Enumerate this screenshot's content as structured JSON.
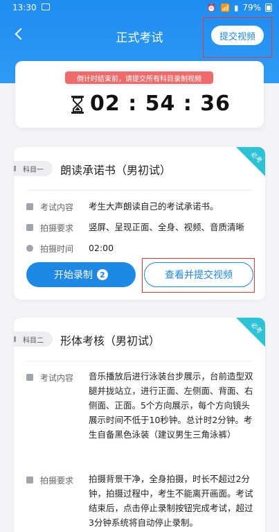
{
  "status_bar": {
    "time": "13:30",
    "battery": "79%",
    "icons": [
      "image-icon",
      "alarm-icon",
      "wifi-icon",
      "signal-icon",
      "battery-icon"
    ]
  },
  "header": {
    "title": "正式考试",
    "submit_video_label": "提交视频"
  },
  "timer": {
    "tip": "倒计时结束前，请提交所有科目录制视频",
    "countdown": "02 : 54 : 36"
  },
  "subjects": [
    {
      "tag": "科目一",
      "title": "朗读承诺书（男初试）",
      "required_label": "必考",
      "rows": [
        {
          "label": "考试内容",
          "value": "考生大声朗读自己的考试承诺书。"
        },
        {
          "label": "拍摄要求",
          "value": "竖屏、呈现正面、全身、视频、音质清晰"
        },
        {
          "label": "拍摄时间",
          "value": "02:00"
        }
      ],
      "start_label": "开始录制",
      "start_badge": "2",
      "view_label": "查看并提交视频"
    },
    {
      "tag": "科目二",
      "title": "形体考核（男初试）",
      "required_label": "必考",
      "rows": [
        {
          "label": "考试内容",
          "value": "音乐播放后进行泳装台步展示，台前造型双腿并拢站立，进行正面、左侧面、背面、右侧面、正面。5个方向展示，每个方向镜头展示时间不低于10秒钟。总计时2分钟。考生自备黑色泳装（建议男生三角泳裤）"
        },
        {
          "label": "拍摄要求",
          "value": "拍摄背景干净，全身拍摄，时长不超过2分钟，拍摄过程中，考生不能离开画面。考试结束后，点击停止录制按钮完成考试，超过3分钟系统将自动停止录制。"
        }
      ]
    }
  ],
  "colors": {
    "primary": "#1e88e5",
    "ribbon": "#2ec2d6",
    "tip_bg": "#f06a6a",
    "highlight": "#e53935"
  }
}
